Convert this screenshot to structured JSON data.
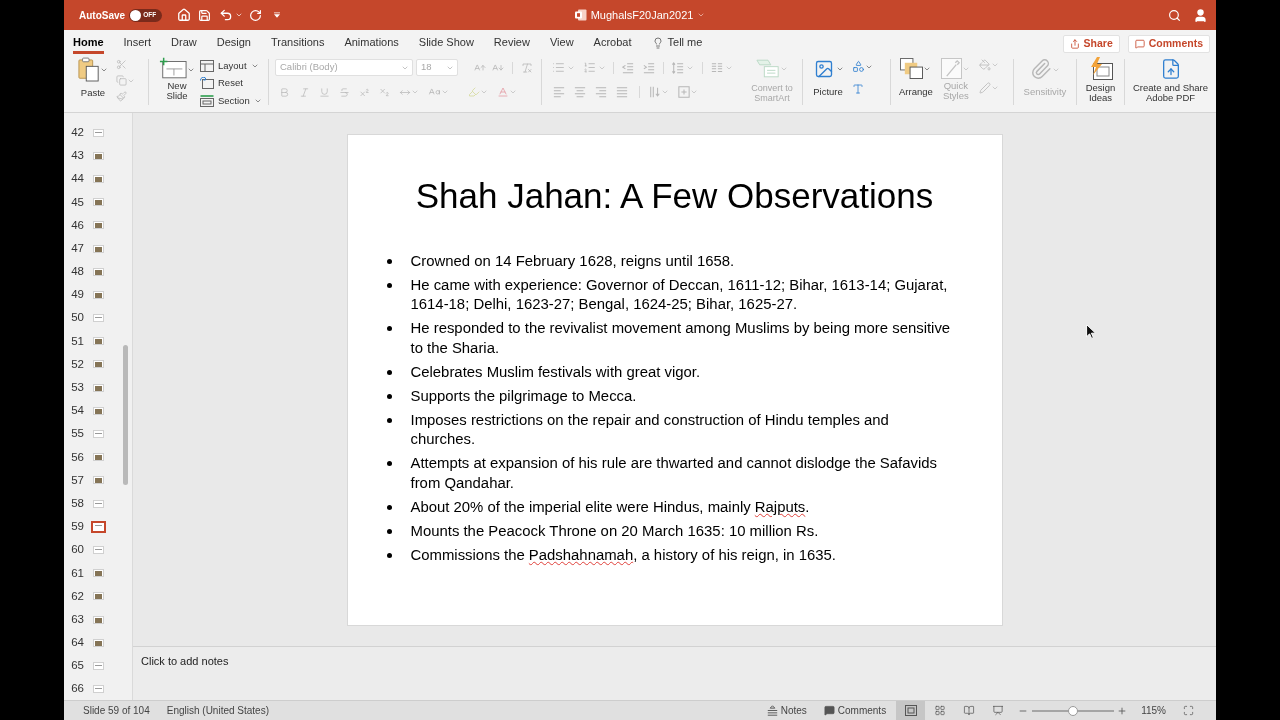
{
  "title_bar": {
    "autosave": {
      "label": "AutoSave",
      "on": false,
      "state_label": "OFF"
    },
    "document_title": "MughalsF20Jan2021"
  },
  "tabs": [
    {
      "label": "Home",
      "selected": true
    },
    {
      "label": "Insert",
      "selected": false
    },
    {
      "label": "Draw",
      "selected": false
    },
    {
      "label": "Design",
      "selected": false
    },
    {
      "label": "Transitions",
      "selected": false
    },
    {
      "label": "Animations",
      "selected": false
    },
    {
      "label": "Slide Show",
      "selected": false
    },
    {
      "label": "Review",
      "selected": false
    },
    {
      "label": "View",
      "selected": false
    },
    {
      "label": "Acrobat",
      "selected": false
    }
  ],
  "tell_me": {
    "label": "Tell me"
  },
  "share_button": {
    "label": "Share"
  },
  "comments_button": {
    "label": "Comments"
  },
  "ribbon": {
    "clipboard": {
      "paste_label": "Paste",
      "tools_disabled": true
    },
    "slides": {
      "new_slide_label": "New Slide",
      "commands": [
        {
          "kind": "layout",
          "label": "Layout",
          "has_menu": true
        },
        {
          "kind": "reset",
          "label": "Reset",
          "has_menu": false
        },
        {
          "kind": "section",
          "label": "Section",
          "has_menu": true
        }
      ]
    },
    "font": {
      "name": "Calibri (Body)",
      "size": "18",
      "disabled": true
    },
    "paragraph": {
      "disabled": true,
      "convert_label": "Convert to SmartArt"
    },
    "insert": {
      "picture_label": "Picture"
    },
    "drawing": {
      "arrange_label": "Arrange",
      "quick_styles_label": "Quick Styles",
      "quick_styles_disabled": true
    },
    "sensitivity": {
      "label": "Sensitivity",
      "disabled": true
    },
    "design_ideas": {
      "label": "Design Ideas"
    },
    "adobe_pdf": {
      "label": "Create and Share Adobe PDF"
    }
  },
  "thumbnails": [
    {
      "number": "42",
      "kind": "text",
      "selected": false
    },
    {
      "number": "43",
      "kind": "picture",
      "selected": false
    },
    {
      "number": "44",
      "kind": "picture",
      "selected": false
    },
    {
      "number": "45",
      "kind": "picture",
      "selected": false
    },
    {
      "number": "46",
      "kind": "picture",
      "selected": false
    },
    {
      "number": "47",
      "kind": "picture",
      "selected": false
    },
    {
      "number": "48",
      "kind": "picture",
      "selected": false
    },
    {
      "number": "49",
      "kind": "picture",
      "selected": false
    },
    {
      "number": "50",
      "kind": "text",
      "selected": false
    },
    {
      "number": "51",
      "kind": "picture",
      "selected": false
    },
    {
      "number": "52",
      "kind": "picture",
      "selected": false
    },
    {
      "number": "53",
      "kind": "picture",
      "selected": false
    },
    {
      "number": "54",
      "kind": "picture",
      "selected": false
    },
    {
      "number": "55",
      "kind": "text",
      "selected": false
    },
    {
      "number": "56",
      "kind": "picture",
      "selected": false
    },
    {
      "number": "57",
      "kind": "picture",
      "selected": false
    },
    {
      "number": "58",
      "kind": "text",
      "selected": false
    },
    {
      "number": "59",
      "kind": "text",
      "selected": true
    },
    {
      "number": "60",
      "kind": "text",
      "selected": false
    },
    {
      "number": "61",
      "kind": "picture",
      "selected": false
    },
    {
      "number": "62",
      "kind": "picture",
      "selected": false
    },
    {
      "number": "63",
      "kind": "picture",
      "selected": false
    },
    {
      "number": "64",
      "kind": "picture",
      "selected": false
    },
    {
      "number": "65",
      "kind": "text",
      "selected": false
    },
    {
      "number": "66",
      "kind": "text",
      "selected": false
    }
  ],
  "slide": {
    "title": "Shah Jahan: A Few Observations",
    "bullets": [
      {
        "parts": [
          {
            "text": "Crowned on 14 February 1628, reigns until 1658.",
            "misspelled": false
          }
        ]
      },
      {
        "parts": [
          {
            "text": "He came with experience: Governor of Deccan, 1611-12; Bihar, 1613-14; Gujarat, 1614-18; Delhi, 1623-27; Bengal, 1624-25; Bihar, 1625-27.",
            "misspelled": false
          }
        ]
      },
      {
        "parts": [
          {
            "text": "He responded to the revivalist movement among Muslims by being more sensitive to the Sharia.",
            "misspelled": false
          }
        ]
      },
      {
        "parts": [
          {
            "text": "Celebrates Muslim festivals with great vigor.",
            "misspelled": false
          }
        ]
      },
      {
        "parts": [
          {
            "text": "Supports the pilgrimage to Mecca.",
            "misspelled": false
          }
        ]
      },
      {
        "parts": [
          {
            "text": "Imposes restrictions on the repair and construction of Hindu temples and churches.",
            "misspelled": false
          }
        ]
      },
      {
        "parts": [
          {
            "text": "Attempts at expansion of his rule are thwarted and cannot dislodge the Safavids from Qandahar.",
            "misspelled": false
          }
        ]
      },
      {
        "parts": [
          {
            "text": "About 20% of the imperial elite were Hindus, mainly ",
            "misspelled": false
          },
          {
            "text": "Rajputs",
            "misspelled": true
          },
          {
            "text": ".",
            "misspelled": false
          }
        ]
      },
      {
        "parts": [
          {
            "text": "Mounts the Peacock Throne on 20 March 1635: 10 million Rs.",
            "misspelled": false
          }
        ]
      },
      {
        "parts": [
          {
            "text": "Commissions the ",
            "misspelled": false
          },
          {
            "text": "Padshahnamah",
            "misspelled": true
          },
          {
            "text": ", a history of his reign, in 1635.",
            "misspelled": false
          }
        ]
      }
    ]
  },
  "notes": {
    "placeholder": "Click to add notes"
  },
  "status_bar": {
    "slide_info": "Slide 59 of 104",
    "language": "English (United States)",
    "notes_button": "Notes",
    "comments_button": "Comments",
    "views": [
      {
        "kind": "normal",
        "selected": true
      },
      {
        "kind": "slide_sorter",
        "selected": false
      },
      {
        "kind": "reading",
        "selected": false
      },
      {
        "kind": "slideshow",
        "selected": false
      }
    ],
    "zoom": {
      "level": 0.5,
      "reading": "115%"
    }
  }
}
